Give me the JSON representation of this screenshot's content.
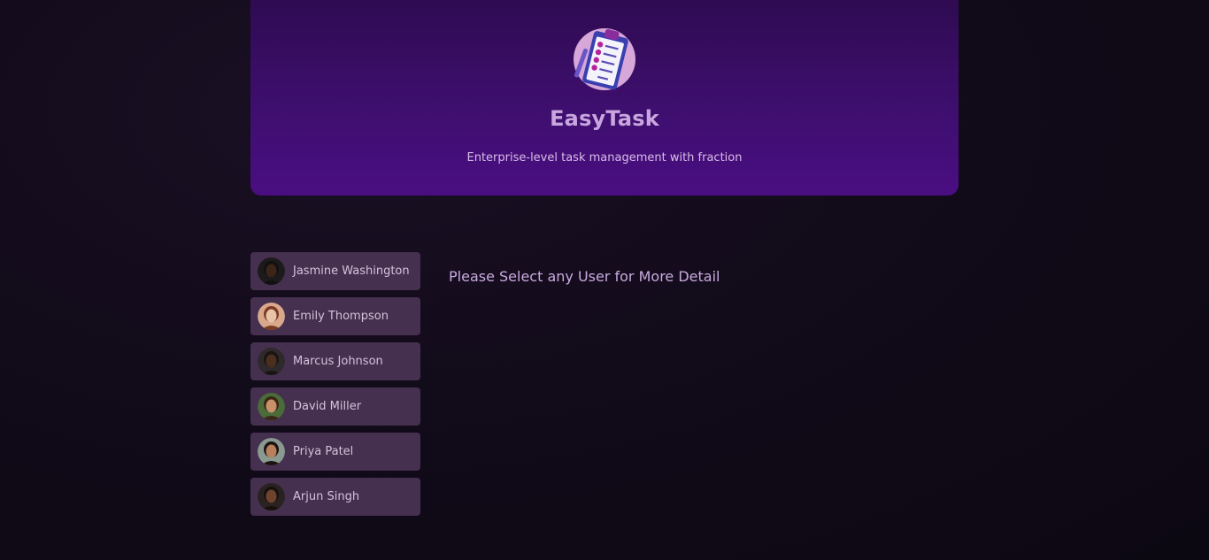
{
  "app": {
    "title": "EasyTask",
    "subtitle": "Enterprise-level task management with fraction",
    "logo_icon": "clipboard-checklist-icon"
  },
  "users": [
    {
      "name": "Jasmine Washington",
      "avatar_skin": "#3b2418",
      "avatar_hair": "#141010",
      "avatar_bg": "#1d1a1c"
    },
    {
      "name": "Emily Thompson",
      "avatar_skin": "#e9c2aa",
      "avatar_hair": "#7a3a22",
      "avatar_bg": "#d9a88c"
    },
    {
      "name": "Marcus Johnson",
      "avatar_skin": "#4a2e1f",
      "avatar_hair": "#1a1412",
      "avatar_bg": "#2e2a2c"
    },
    {
      "name": "David Miller",
      "avatar_skin": "#c8916a",
      "avatar_hair": "#3b2616",
      "avatar_bg": "#4a6b3a"
    },
    {
      "name": "Priya Patel",
      "avatar_skin": "#b9805e",
      "avatar_hair": "#1c1310",
      "avatar_bg": "#8a9a90"
    },
    {
      "name": "Arjun Singh",
      "avatar_skin": "#6e4430",
      "avatar_hair": "#17110e",
      "avatar_bg": "#2a2220"
    }
  ],
  "main": {
    "prompt": "Please Select any User for More Detail"
  },
  "colors": {
    "header_top": "#2f0b52",
    "header_bottom": "#4a0e82",
    "user_item_bg": "#45304f",
    "accent_text": "#c9a9e0"
  }
}
